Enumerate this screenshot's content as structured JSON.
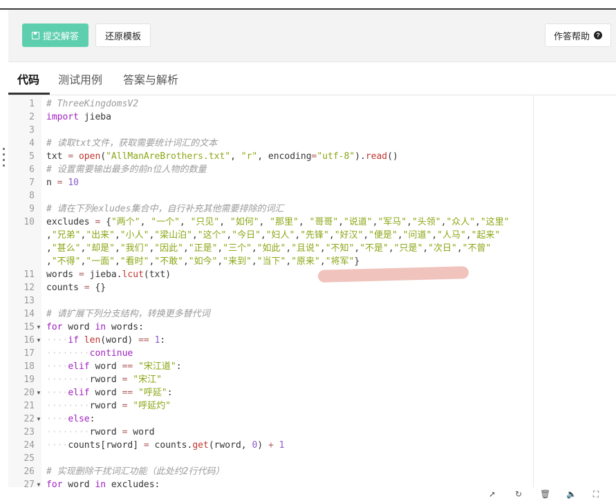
{
  "toolbar": {
    "submit_label": "提交解答",
    "reset_label": "还原模板",
    "help_label": "作答帮助"
  },
  "tabs": [
    {
      "label": "代码",
      "active": true
    },
    {
      "label": "测试用例",
      "active": false
    },
    {
      "label": "答案与解析",
      "active": false
    }
  ],
  "editor": {
    "line_numbers": [
      "1",
      "2",
      "3",
      "4",
      "5",
      "6",
      "7",
      "8",
      "9",
      "10",
      "",
      "",
      "",
      "11",
      "12",
      "13",
      "14",
      "15",
      "16",
      "17",
      "18",
      "19",
      "20",
      "21",
      "22",
      "23",
      "24",
      "25",
      "26",
      "27"
    ],
    "lines": [
      "# ThreeKingdomsV2",
      "import jieba",
      "",
      "# 读取txt文件，获取需要统计词汇的文本",
      "txt = open(\"AllManAreBrothers.txt\", \"r\", encoding=\"utf-8\").read()",
      "# 设置需要输出最多的前n位人物的数量",
      "n = 10",
      "",
      "# 请在下列exludes集合中，自行补充其他需要排除的词汇",
      "excludes = {\"两个\", \"一个\", \"只见\", \"如何\", \"那里\", \"哥哥\",\"说道\",\"军马\",\"头领\",\"众人\",\"这里\"",
      ",\"兄弟\",\"出来\",\"小人\",\"梁山泊\",\"这个\",\"今日\",\"妇人\",\"先锋\",\"好汉\",\"便是\",\"问道\",\"人马\",\"起来\"",
      ",\"甚么\",\"却是\",\"我们\",\"因此\",\"正是\",\"三个\",\"如此\",\"且说\",\"不知\",\"不是\",\"只是\",\"次日\",\"不曾\"",
      ",\"不得\",\"一面\",\"看时\",\"不敢\",\"如今\",\"来到\",\"当下\",\"原来\",\"将军\"}",
      "words = jieba.lcut(txt)",
      "counts = {}",
      "",
      "# 请扩展下列分支结构，转换更多替代词",
      "for word in words:",
      "    if len(word) == 1:",
      "        continue",
      "    elif word == \"宋江道\":",
      "        rword = \"宋江\"",
      "    elif word == \"呼延\":",
      "        rword = \"呼延灼\"",
      "    else:",
      "        rword = word",
      "    counts[rword] = counts.get(rword, 0) + 1",
      "",
      "# 实现删除干扰词汇功能（此处约2行代码）",
      "for word in excludes:"
    ],
    "fold_lines": [
      "15",
      "16",
      "20",
      "22",
      "27"
    ]
  },
  "statusbar": {
    "icons": [
      "rocket-icon",
      "refresh-icon",
      "trash-icon",
      "volume-icon",
      "fullscreen-icon"
    ]
  }
}
